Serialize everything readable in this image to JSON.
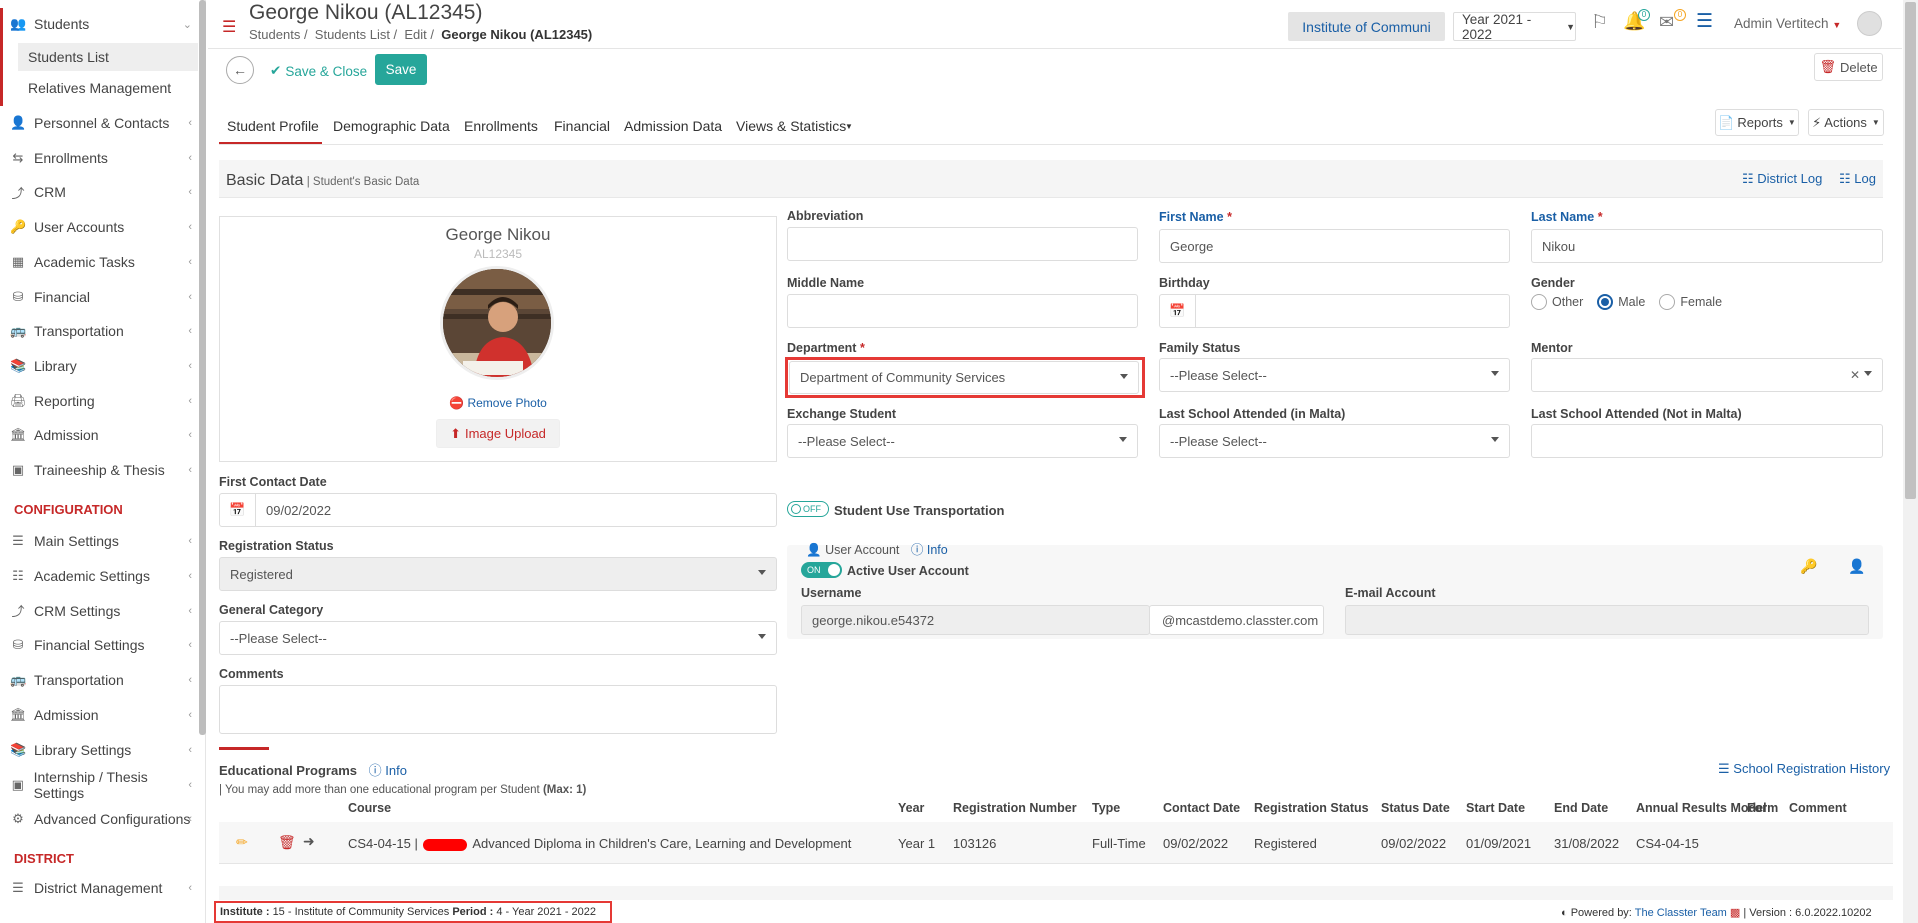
{
  "sidebar": {
    "students": "Students",
    "students_list": "Students List",
    "relatives": "Relatives Management",
    "items": [
      {
        "label": "Personnel & Contacts",
        "icon": "person-icon"
      },
      {
        "label": "Enrollments",
        "icon": "arrows-icon"
      },
      {
        "label": "CRM",
        "icon": "crm-icon"
      },
      {
        "label": "User Accounts",
        "icon": "key-icon"
      },
      {
        "label": "Academic Tasks",
        "icon": "tasks-icon"
      },
      {
        "label": "Financial",
        "icon": "coins-icon"
      },
      {
        "label": "Transportation",
        "icon": "bus-icon"
      },
      {
        "label": "Library",
        "icon": "books-icon"
      },
      {
        "label": "Reporting",
        "icon": "printer-icon"
      },
      {
        "label": "Admission",
        "icon": "bank-icon"
      },
      {
        "label": "Traineeship & Thesis",
        "icon": "cube-icon"
      }
    ],
    "config_heading": "CONFIGURATION",
    "config_items": [
      {
        "label": "Main Settings",
        "icon": "sliders-icon"
      },
      {
        "label": "Academic Settings",
        "icon": "sitemap-icon"
      },
      {
        "label": "CRM Settings",
        "icon": "crm-icon"
      },
      {
        "label": "Financial Settings",
        "icon": "coins-icon"
      },
      {
        "label": "Transportation",
        "icon": "bus-icon"
      },
      {
        "label": "Admission",
        "icon": "bank-icon"
      },
      {
        "label": "Library Settings",
        "icon": "books-icon"
      },
      {
        "label": "Internship / Thesis Settings",
        "icon": "cube-icon"
      },
      {
        "label": "Advanced Configurations",
        "icon": "gears-icon"
      }
    ],
    "district_heading": "DISTRICT",
    "district_items": [
      {
        "label": "District Management",
        "icon": "list-icon"
      }
    ]
  },
  "header": {
    "title": "George Nikou (AL12345)",
    "breadcrumb": [
      "Students",
      "Students List",
      "Edit",
      "George Nikou (AL12345)"
    ],
    "institute": "Institute of Communi",
    "year": "Year 2021 - 2022",
    "notif_count": "0",
    "mail_count": "0",
    "user": "Admin Vertitech"
  },
  "toolbar": {
    "save_close": "Save & Close",
    "save": "Save",
    "delete": "Delete"
  },
  "tabs": [
    "Student Profile",
    "Demographic Data",
    "Enrollments",
    "Financial",
    "Admission Data",
    "Views & Statistics"
  ],
  "reports": "Reports",
  "actions": "Actions",
  "section": {
    "title": "Basic Data",
    "subtitle": "| Student's Basic Data",
    "district_log": "District Log",
    "log": "Log"
  },
  "profile": {
    "name": "George Nikou",
    "code": "AL12345",
    "remove_photo": "Remove Photo",
    "image_upload": "Image Upload"
  },
  "form": {
    "abbreviation_label": "Abbreviation",
    "abbreviation_value": "",
    "first_name_label": "First Name",
    "first_name_value": "George",
    "last_name_label": "Last Name",
    "last_name_value": "Nikou",
    "middle_name_label": "Middle Name",
    "birthday_label": "Birthday",
    "gender_label": "Gender",
    "gender_options": [
      "Other",
      "Male",
      "Female"
    ],
    "gender_selected": "Male",
    "department_label": "Department",
    "department_value": "Department of Community Services",
    "family_status_label": "Family Status",
    "family_status_value": "--Please Select--",
    "mentor_label": "Mentor",
    "exchange_label": "Exchange Student",
    "exchange_value": "--Please Select--",
    "last_school_malta_label": "Last School Attended (in Malta)",
    "last_school_malta_value": "--Please Select--",
    "last_school_not_malta_label": "Last School Attended (Not in Malta)",
    "first_contact_label": "First Contact Date",
    "first_contact_value": "09/02/2022",
    "transport_toggle": "OFF",
    "transport_label": "Student Use Transportation",
    "reg_status_label": "Registration Status",
    "reg_status_value": "Registered",
    "general_cat_label": "General Category",
    "general_cat_value": "--Please Select--",
    "comments_label": "Comments"
  },
  "user_account": {
    "title": "User Account",
    "info": "Info",
    "toggle": "ON",
    "active_label": "Active User Account",
    "username_label": "Username",
    "username_value": "george.nikou.e54372",
    "domain": "@mcastdemo.classter.com",
    "email_label": "E-mail Account"
  },
  "programs": {
    "title": "Educational Programs",
    "info": "Info",
    "history": "School Registration History",
    "note": "| You may add more than one educational program per Student",
    "max": "(Max: 1)",
    "columns": [
      "Course",
      "Year",
      "Registration Number",
      "Type",
      "Contact Date",
      "Registration Status",
      "Status Date",
      "Start Date",
      "End Date",
      "Annual Results Model",
      "Form",
      "Comment"
    ],
    "row": {
      "code": "CS4-04-15 |",
      "course": "Advanced Diploma in Children's Care, Learning and Development",
      "year": "Year 1",
      "reg_number": "103126",
      "type": "Full-Time",
      "contact_date": "09/02/2022",
      "reg_status": "Registered",
      "status_date": "09/02/2022",
      "start_date": "01/09/2021",
      "end_date": "31/08/2022",
      "model": "CS4-04-15"
    }
  },
  "footer": {
    "institute_label": "Institute :",
    "institute_value": "15 - Institute of Community Services",
    "period_label": "Period :",
    "period_value": "4 - Year 2021 - 2022",
    "powered": "Powered by:",
    "team": "The Classter Team",
    "version": "| Version : 6.0.2022.10202"
  },
  "colors": {
    "accent": "#c62828",
    "primary": "#26a69a",
    "link": "#1a5fa6",
    "highlight": "#e53935"
  }
}
